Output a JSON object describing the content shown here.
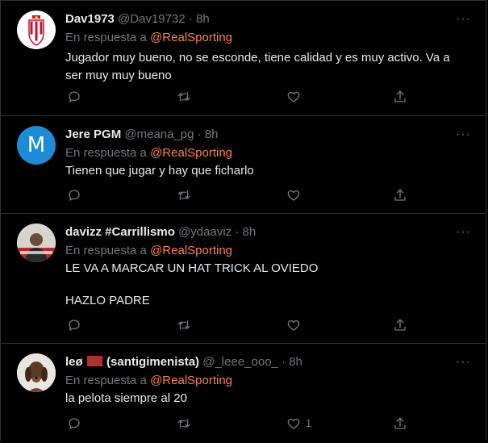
{
  "tweets": [
    {
      "name": "Dav1973",
      "handle": "@Dav19732",
      "sep": "·",
      "time": "8h",
      "reply_prefix": "En respuesta a",
      "reply_mention": "@RealSporting",
      "text": "Jugador muy bueno, no se esconde, tiene calidad y es muy activo. Va a ser muy muy bueno",
      "more": "···"
    },
    {
      "name": "Jere PGM",
      "handle": "@meana_pg",
      "sep": "·",
      "time": "8h",
      "avatar_letter": "M",
      "reply_prefix": "En respuesta a",
      "reply_mention": "@RealSporting",
      "text": "Tienen que jugar y hay que ficharlo",
      "more": "···"
    },
    {
      "name": "davizz #Carrillismo",
      "handle": "@ydaaviz",
      "sep": "·",
      "time": "8h",
      "reply_prefix": "En respuesta a",
      "reply_mention": "@RealSporting",
      "text_line1": "LE VA A MARCAR UN HAT TRICK AL OVIEDO",
      "text_line2": "HAZLO PADRE",
      "more": "···"
    },
    {
      "name_part1": "leø",
      "name_part2": "(santigimenista)",
      "handle": "@_leee_ooo_",
      "sep": "·",
      "time": "8h",
      "reply_prefix": "En respuesta a",
      "reply_mention": "@RealSporting",
      "text": "la pelota siempre al 20",
      "like_count": "1",
      "more": "···"
    }
  ],
  "icons": {
    "reply": "reply-icon",
    "retweet": "retweet-icon",
    "like": "like-icon",
    "share": "share-icon",
    "flag": "morocco-flag-icon"
  },
  "colors": {
    "background": "#000000",
    "text": "#e7e9ea",
    "muted": "#71767b",
    "mention": "#f4824d",
    "divider": "#2f3336",
    "avatar_blue": "#1d8bd6"
  }
}
